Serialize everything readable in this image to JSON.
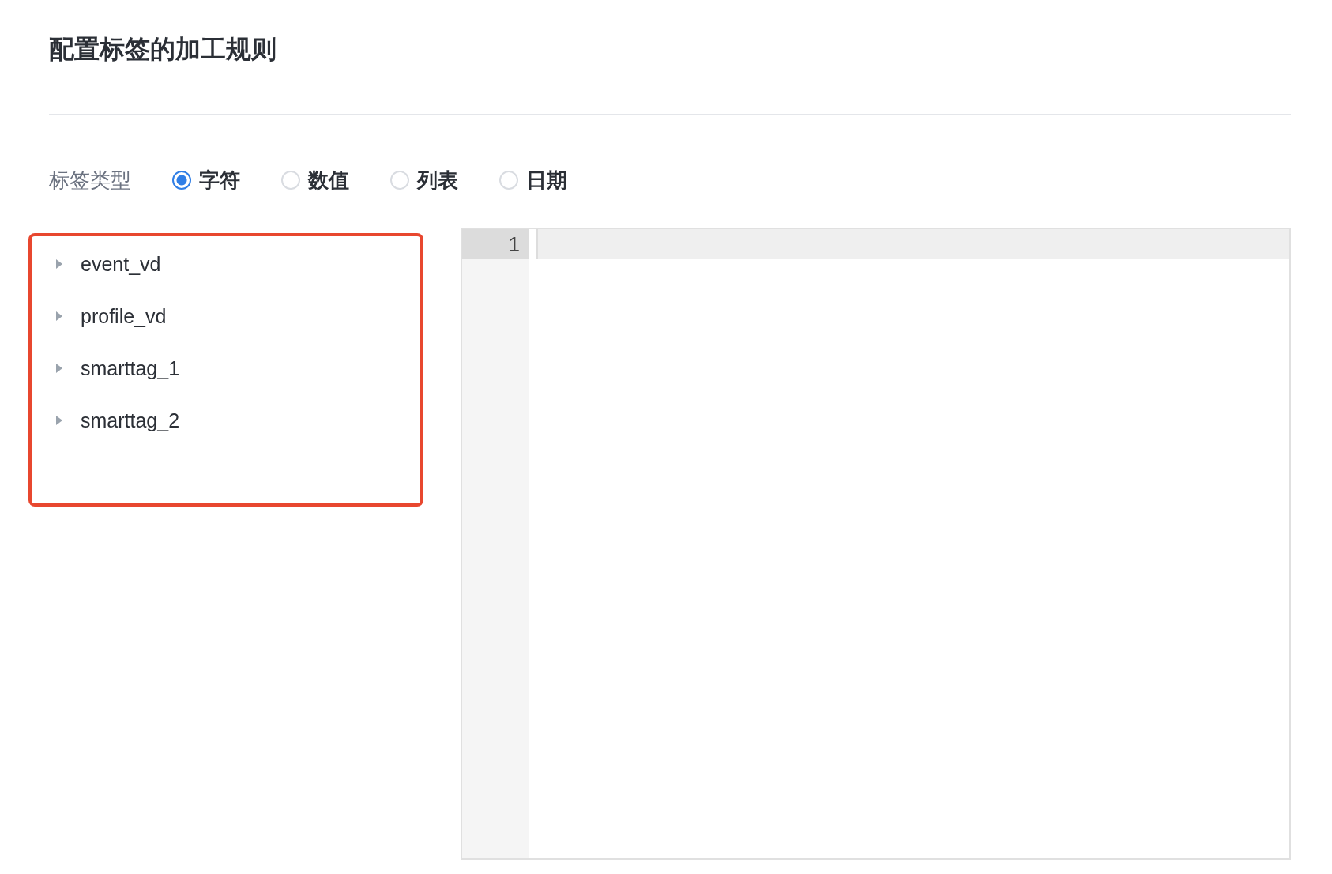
{
  "title": "配置标签的加工规则",
  "tag_type": {
    "label": "标签类型",
    "options": [
      {
        "label": "字符",
        "selected": true
      },
      {
        "label": "数值",
        "selected": false
      },
      {
        "label": "列表",
        "selected": false
      },
      {
        "label": "日期",
        "selected": false
      }
    ]
  },
  "tree": {
    "items": [
      {
        "label": "event_vd",
        "expanded": false
      },
      {
        "label": "profile_vd",
        "expanded": false
      },
      {
        "label": "smarttag_1",
        "expanded": false
      },
      {
        "label": "smarttag_2",
        "expanded": false
      }
    ]
  },
  "editor": {
    "line_numbers": [
      "1"
    ]
  }
}
